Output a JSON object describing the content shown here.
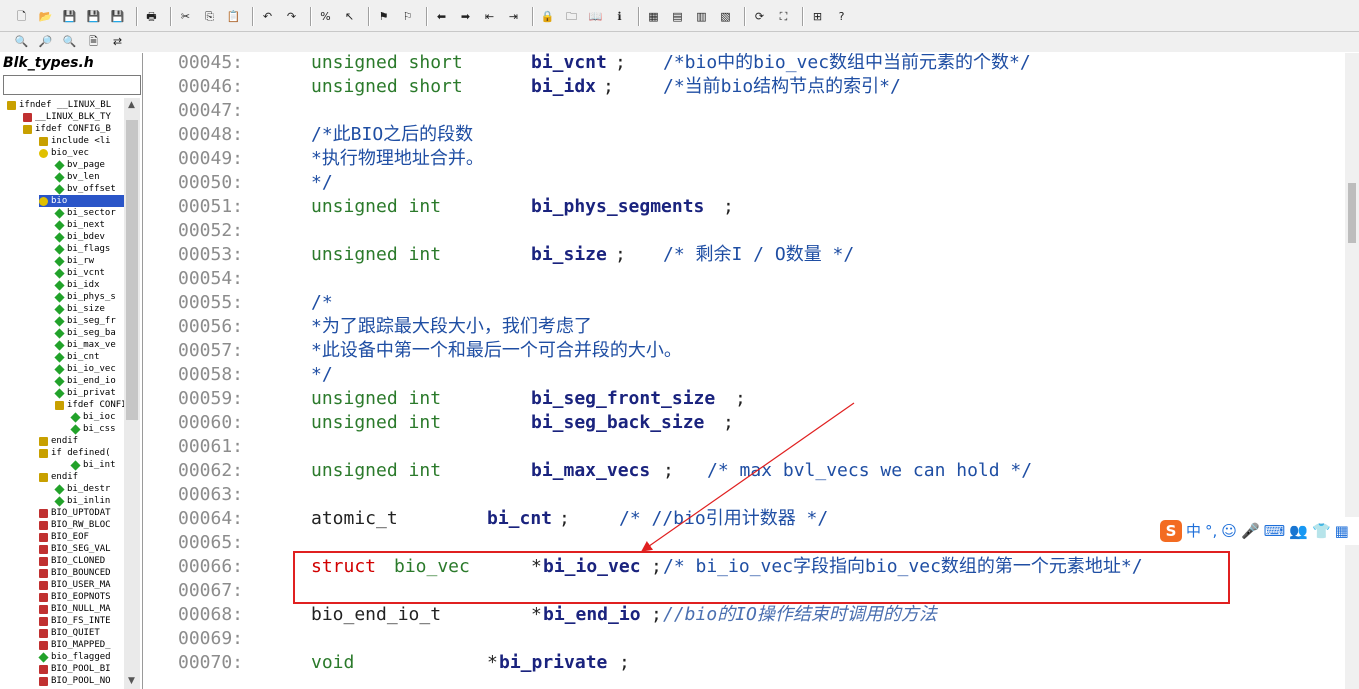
{
  "toolbar": {
    "row1": [
      "new-file",
      "open",
      "save",
      "save-as",
      "save-all",
      "print",
      "cut",
      "copy",
      "paste",
      "undo",
      "redo",
      "lookup-symbol",
      "select-pointer",
      "bookmark-set",
      "bookmark-clear",
      "back",
      "forward",
      "jump-prev",
      "jump-next",
      "lock",
      "browse",
      "book",
      "info",
      "tile-1",
      "tile-2",
      "tile-3",
      "tile-4",
      "refresh",
      "relation",
      "tree",
      "help"
    ],
    "row2": [
      "find",
      "find-next",
      "find-prev",
      "find-in-files",
      "replace"
    ]
  },
  "symbol_panel": {
    "title": "Blk_types.h",
    "search_value": "",
    "items": [
      {
        "label": "ifndef __LINUX_BL",
        "type": "def",
        "depth": 0
      },
      {
        "label": "__LINUX_BLK_TY",
        "type": "hash",
        "depth": 1
      },
      {
        "label": "ifdef CONFIG_B",
        "type": "def",
        "depth": 1
      },
      {
        "label": "include <li",
        "type": "inc",
        "depth": 2
      },
      {
        "label": "bio_vec",
        "type": "struct",
        "depth": 2
      },
      {
        "label": "bv_page",
        "type": "member",
        "depth": 3
      },
      {
        "label": "bv_len",
        "type": "member",
        "depth": 3
      },
      {
        "label": "bv_offset",
        "type": "member",
        "depth": 3
      },
      {
        "label": "bio",
        "type": "struct",
        "depth": 2,
        "selected": true
      },
      {
        "label": "bi_sector",
        "type": "member",
        "depth": 3
      },
      {
        "label": "bi_next",
        "type": "member",
        "depth": 3
      },
      {
        "label": "bi_bdev",
        "type": "member",
        "depth": 3
      },
      {
        "label": "bi_flags",
        "type": "member",
        "depth": 3
      },
      {
        "label": "bi_rw",
        "type": "member",
        "depth": 3
      },
      {
        "label": "bi_vcnt",
        "type": "member",
        "depth": 3
      },
      {
        "label": "bi_idx",
        "type": "member",
        "depth": 3
      },
      {
        "label": "bi_phys_s",
        "type": "member",
        "depth": 3
      },
      {
        "label": "bi_size",
        "type": "member",
        "depth": 3
      },
      {
        "label": "bi_seg_fr",
        "type": "member",
        "depth": 3
      },
      {
        "label": "bi_seg_ba",
        "type": "member",
        "depth": 3
      },
      {
        "label": "bi_max_ve",
        "type": "member",
        "depth": 3
      },
      {
        "label": "bi_cnt",
        "type": "member",
        "depth": 3
      },
      {
        "label": "bi_io_vec",
        "type": "member",
        "depth": 3
      },
      {
        "label": "bi_end_io",
        "type": "member",
        "depth": 3
      },
      {
        "label": "bi_privat",
        "type": "member",
        "depth": 3
      },
      {
        "label": "ifdef CONFI",
        "type": "def",
        "depth": 3
      },
      {
        "label": "bi_ioc",
        "type": "member",
        "depth": 4
      },
      {
        "label": "bi_css",
        "type": "member",
        "depth": 4
      },
      {
        "label": "endif",
        "type": "def",
        "depth": 2
      },
      {
        "label": "if defined(",
        "type": "def",
        "depth": 2
      },
      {
        "label": "bi_int",
        "type": "member",
        "depth": 4
      },
      {
        "label": "endif",
        "type": "def",
        "depth": 2
      },
      {
        "label": "bi_destr",
        "type": "member",
        "depth": 3
      },
      {
        "label": "bi_inlin",
        "type": "member",
        "depth": 3
      },
      {
        "label": "BIO_UPTODAT",
        "type": "hash",
        "depth": 2
      },
      {
        "label": "BIO_RW_BLOC",
        "type": "hash",
        "depth": 2
      },
      {
        "label": "BIO_EOF",
        "type": "hash",
        "depth": 2
      },
      {
        "label": "BIO_SEG_VAL",
        "type": "hash",
        "depth": 2
      },
      {
        "label": "BIO_CLONED",
        "type": "hash",
        "depth": 2
      },
      {
        "label": "BIO_BOUNCED",
        "type": "hash",
        "depth": 2
      },
      {
        "label": "BIO_USER_MA",
        "type": "hash",
        "depth": 2
      },
      {
        "label": "BIO_EOPNOTS",
        "type": "hash",
        "depth": 2
      },
      {
        "label": "BIO_NULL_MA",
        "type": "hash",
        "depth": 2
      },
      {
        "label": "BIO_FS_INTE",
        "type": "hash",
        "depth": 2
      },
      {
        "label": "BIO_QUIET",
        "type": "hash",
        "depth": 2
      },
      {
        "label": "BIO_MAPPED_",
        "type": "hash",
        "depth": 2
      },
      {
        "label": "bio_flagged",
        "type": "func",
        "depth": 2
      },
      {
        "label": "BIO_POOL_BI",
        "type": "hash",
        "depth": 2
      },
      {
        "label": "BIO_POOL_NO",
        "type": "hash",
        "depth": 2
      }
    ]
  },
  "code": [
    {
      "n": "00045:",
      "segs": [
        [
          "unsigned short",
          "kw",
          311
        ],
        [
          "bi_vcnt",
          "id",
          531
        ],
        [
          ";",
          "plain",
          615
        ],
        [
          "/*bio中的bio_vec数组中当前元素的个数*/",
          "cmt",
          663
        ]
      ]
    },
    {
      "n": "00046:",
      "segs": [
        [
          "unsigned short",
          "kw",
          311
        ],
        [
          "bi_idx",
          "id",
          531
        ],
        [
          ";",
          "plain",
          603
        ],
        [
          "/*当前bio结构节点的索引*/",
          "cmt",
          663
        ]
      ]
    },
    {
      "n": "00047:",
      "segs": []
    },
    {
      "n": "00048:",
      "segs": [
        [
          "/*此BIO之后的段数",
          "cmt",
          311
        ]
      ]
    },
    {
      "n": "00049:",
      "segs": [
        [
          "*执行物理地址合并。",
          "cmt",
          311
        ]
      ]
    },
    {
      "n": "00050:",
      "segs": [
        [
          "*/",
          "cmt",
          311
        ]
      ]
    },
    {
      "n": "00051:",
      "segs": [
        [
          "unsigned int",
          "kw",
          311
        ],
        [
          "bi_phys_segments",
          "id",
          531
        ],
        [
          ";",
          "plain",
          723
        ]
      ]
    },
    {
      "n": "00052:",
      "segs": []
    },
    {
      "n": "00053:",
      "segs": [
        [
          "unsigned int",
          "kw",
          311
        ],
        [
          "bi_size",
          "id",
          531
        ],
        [
          ";",
          "plain",
          615
        ],
        [
          "/* 剩余I / O数量 */",
          "cmt",
          663
        ]
      ]
    },
    {
      "n": "00054:",
      "segs": []
    },
    {
      "n": "00055:",
      "segs": [
        [
          "/*",
          "cmt",
          311
        ]
      ]
    },
    {
      "n": "00056:",
      "segs": [
        [
          "*为了跟踪最大段大小，我们考虑了",
          "cmt",
          311
        ]
      ]
    },
    {
      "n": "00057:",
      "segs": [
        [
          "*此设备中第一个和最后一个可合并段的大小。",
          "cmt",
          311
        ]
      ]
    },
    {
      "n": "00058:",
      "segs": [
        [
          "*/",
          "cmt",
          311
        ]
      ]
    },
    {
      "n": "00059:",
      "segs": [
        [
          "unsigned int",
          "kw",
          311
        ],
        [
          "bi_seg_front_size",
          "id",
          531
        ],
        [
          ";",
          "plain",
          735
        ]
      ]
    },
    {
      "n": "00060:",
      "segs": [
        [
          "unsigned int",
          "kw",
          311
        ],
        [
          "bi_seg_back_size",
          "id",
          531
        ],
        [
          ";",
          "plain",
          723
        ]
      ]
    },
    {
      "n": "00061:",
      "segs": []
    },
    {
      "n": "00062:",
      "segs": [
        [
          "unsigned int",
          "kw",
          311
        ],
        [
          "bi_max_vecs",
          "id",
          531
        ],
        [
          ";",
          "plain",
          663
        ],
        [
          "/* max bvl_vecs we can hold */",
          "cmt",
          707
        ]
      ]
    },
    {
      "n": "00063:",
      "segs": []
    },
    {
      "n": "00064:",
      "segs": [
        [
          "atomic_t",
          "plain",
          311
        ],
        [
          "bi_cnt",
          "id",
          487
        ],
        [
          ";",
          "plain",
          559
        ],
        [
          "/* //bio引用计数器 */",
          "cmt",
          619
        ]
      ]
    },
    {
      "n": "00065:",
      "segs": []
    },
    {
      "n": "00066:",
      "segs": [
        [
          "struct",
          "kw-struct",
          311
        ],
        [
          "bio_vec",
          "kw",
          394
        ],
        [
          "*",
          "plain",
          531
        ],
        [
          "bi_io_vec",
          "id",
          543
        ],
        [
          ";",
          "plain",
          651
        ],
        [
          "/* bi_io_vec字段指向bio_vec数组的第一个元素地址*/",
          "cmt",
          663
        ]
      ]
    },
    {
      "n": "00067:",
      "segs": []
    },
    {
      "n": "00068:",
      "segs": [
        [
          "bio_end_io_t",
          "plain",
          311
        ],
        [
          "*",
          "plain",
          531
        ],
        [
          "bi_end_io",
          "id",
          543
        ],
        [
          ";",
          "plain",
          651
        ],
        [
          "//bio的IO操作结束时调用的方法",
          "cmt-it",
          663
        ]
      ]
    },
    {
      "n": "00069:",
      "segs": []
    },
    {
      "n": "00070:",
      "segs": [
        [
          "void",
          "kw",
          311
        ],
        [
          "*",
          "plain",
          487
        ],
        [
          "bi_private",
          "id",
          499
        ],
        [
          ";",
          "plain",
          619
        ]
      ]
    }
  ],
  "ime": {
    "logo": "S",
    "mode": "中",
    "punct": "°,"
  },
  "colors": {
    "annotation": "#e02020",
    "keyword": "#2b7a2b",
    "struct": "#d10000",
    "comment": "#1f4ea3",
    "identifier": "#1a237e",
    "line_number": "#8c8c8c"
  }
}
